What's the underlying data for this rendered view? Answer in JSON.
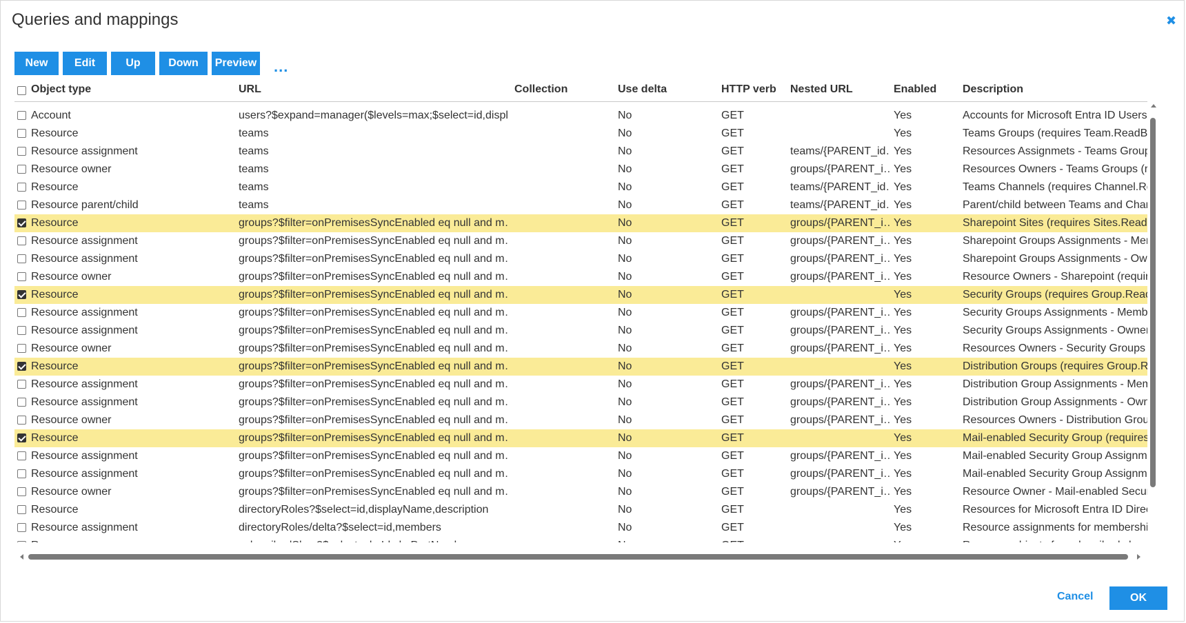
{
  "dialog": {
    "title": "Queries and mappings",
    "close_icon": "close-icon",
    "cancel_label": "Cancel",
    "ok_label": "OK"
  },
  "toolbar": {
    "buttons": [
      {
        "label": "New"
      },
      {
        "label": "Edit"
      },
      {
        "label": "Up"
      },
      {
        "label": "Down"
      },
      {
        "label": "Preview"
      }
    ],
    "more_label": "..."
  },
  "colors": {
    "accent": "#1f8fe5",
    "selected_row": "#faeb97"
  },
  "table": {
    "columns": [
      "Object type",
      "URL",
      "Collection",
      "Use delta",
      "HTTP verb",
      "Nested URL",
      "Enabled",
      "Description"
    ],
    "rows": [
      {
        "checked": false,
        "type": "Account",
        "url": "users?$expand=manager($levels=max;$select=id,displ…",
        "collection": "",
        "delta": "No",
        "verb": "GET",
        "nested": "",
        "enabled": "Yes",
        "desc": "Accounts for Microsoft Entra ID Users ("
      },
      {
        "checked": false,
        "type": "Resource",
        "url": "teams",
        "collection": "",
        "delta": "No",
        "verb": "GET",
        "nested": "",
        "enabled": "Yes",
        "desc": "Teams Groups (requires Team.ReadBa"
      },
      {
        "checked": false,
        "type": "Resource assignment",
        "url": "teams",
        "collection": "",
        "delta": "No",
        "verb": "GET",
        "nested": "teams/{PARENT_id…",
        "enabled": "Yes",
        "desc": "Resources Assignmets - Teams Groups"
      },
      {
        "checked": false,
        "type": "Resource owner",
        "url": "teams",
        "collection": "",
        "delta": "No",
        "verb": "GET",
        "nested": "groups/{PARENT_i…",
        "enabled": "Yes",
        "desc": "Resources Owners - Teams Groups (re"
      },
      {
        "checked": false,
        "type": "Resource",
        "url": "teams",
        "collection": "",
        "delta": "No",
        "verb": "GET",
        "nested": "teams/{PARENT_id…",
        "enabled": "Yes",
        "desc": "Teams Channels (requires Channel.Rea"
      },
      {
        "checked": false,
        "type": "Resource parent/child",
        "url": "teams",
        "collection": "",
        "delta": "No",
        "verb": "GET",
        "nested": "teams/{PARENT_id…",
        "enabled": "Yes",
        "desc": "Parent/child between Teams and Chan"
      },
      {
        "checked": true,
        "type": "Resource",
        "url": "groups?$filter=onPremisesSyncEnabled eq null and m…",
        "collection": "",
        "delta": "No",
        "verb": "GET",
        "nested": "groups/{PARENT_i…",
        "enabled": "Yes",
        "desc": "Sharepoint Sites (requires Sites.Read.A"
      },
      {
        "checked": false,
        "type": "Resource assignment",
        "url": "groups?$filter=onPremisesSyncEnabled eq null and m…",
        "collection": "",
        "delta": "No",
        "verb": "GET",
        "nested": "groups/{PARENT_i…",
        "enabled": "Yes",
        "desc": "Sharepoint Groups Assignments - Mem"
      },
      {
        "checked": false,
        "type": "Resource assignment",
        "url": "groups?$filter=onPremisesSyncEnabled eq null and m…",
        "collection": "",
        "delta": "No",
        "verb": "GET",
        "nested": "groups/{PARENT_i…",
        "enabled": "Yes",
        "desc": "Sharepoint Groups Assignments - Own"
      },
      {
        "checked": false,
        "type": "Resource owner",
        "url": "groups?$filter=onPremisesSyncEnabled eq null and m…",
        "collection": "",
        "delta": "No",
        "verb": "GET",
        "nested": "groups/{PARENT_i…",
        "enabled": "Yes",
        "desc": "Resource Owners - Sharepoint (require"
      },
      {
        "checked": true,
        "type": "Resource",
        "url": "groups?$filter=onPremisesSyncEnabled eq null and m…",
        "collection": "",
        "delta": "No",
        "verb": "GET",
        "nested": "",
        "enabled": "Yes",
        "desc": "Security Groups (requires Group.Read."
      },
      {
        "checked": false,
        "type": "Resource assignment",
        "url": "groups?$filter=onPremisesSyncEnabled eq null and m…",
        "collection": "",
        "delta": "No",
        "verb": "GET",
        "nested": "groups/{PARENT_i…",
        "enabled": "Yes",
        "desc": "Security Groups Assignments - Membe"
      },
      {
        "checked": false,
        "type": "Resource assignment",
        "url": "groups?$filter=onPremisesSyncEnabled eq null and m…",
        "collection": "",
        "delta": "No",
        "verb": "GET",
        "nested": "groups/{PARENT_i…",
        "enabled": "Yes",
        "desc": "Security Groups Assignments - Owners"
      },
      {
        "checked": false,
        "type": "Resource owner",
        "url": "groups?$filter=onPremisesSyncEnabled eq null and m…",
        "collection": "",
        "delta": "No",
        "verb": "GET",
        "nested": "groups/{PARENT_i…",
        "enabled": "Yes",
        "desc": "Resources Owners - Security Groups (r"
      },
      {
        "checked": true,
        "type": "Resource",
        "url": "groups?$filter=onPremisesSyncEnabled eq null and m…",
        "collection": "",
        "delta": "No",
        "verb": "GET",
        "nested": "",
        "enabled": "Yes",
        "desc": "Distribution Groups (requires Group.Re"
      },
      {
        "checked": false,
        "type": "Resource assignment",
        "url": "groups?$filter=onPremisesSyncEnabled eq null and m…",
        "collection": "",
        "delta": "No",
        "verb": "GET",
        "nested": "groups/{PARENT_i…",
        "enabled": "Yes",
        "desc": "Distribution Group Assignments - Mem"
      },
      {
        "checked": false,
        "type": "Resource assignment",
        "url": "groups?$filter=onPremisesSyncEnabled eq null and m…",
        "collection": "",
        "delta": "No",
        "verb": "GET",
        "nested": "groups/{PARENT_i…",
        "enabled": "Yes",
        "desc": "Distribution Group Assignments - Own"
      },
      {
        "checked": false,
        "type": "Resource owner",
        "url": "groups?$filter=onPremisesSyncEnabled eq null and m…",
        "collection": "",
        "delta": "No",
        "verb": "GET",
        "nested": "groups/{PARENT_i…",
        "enabled": "Yes",
        "desc": "Resources Owners - Distribution Grouj"
      },
      {
        "checked": true,
        "type": "Resource",
        "url": "groups?$filter=onPremisesSyncEnabled eq null and m…",
        "collection": "",
        "delta": "No",
        "verb": "GET",
        "nested": "",
        "enabled": "Yes",
        "desc": "Mail-enabled Security Group (requires"
      },
      {
        "checked": false,
        "type": "Resource assignment",
        "url": "groups?$filter=onPremisesSyncEnabled eq null and m…",
        "collection": "",
        "delta": "No",
        "verb": "GET",
        "nested": "groups/{PARENT_i…",
        "enabled": "Yes",
        "desc": "Mail-enabled Security Group Assignme"
      },
      {
        "checked": false,
        "type": "Resource assignment",
        "url": "groups?$filter=onPremisesSyncEnabled eq null and m…",
        "collection": "",
        "delta": "No",
        "verb": "GET",
        "nested": "groups/{PARENT_i…",
        "enabled": "Yes",
        "desc": "Mail-enabled Security Group Assignme"
      },
      {
        "checked": false,
        "type": "Resource owner",
        "url": "groups?$filter=onPremisesSyncEnabled eq null and m…",
        "collection": "",
        "delta": "No",
        "verb": "GET",
        "nested": "groups/{PARENT_i…",
        "enabled": "Yes",
        "desc": "Resource Owner - Mail-enabled Securit"
      },
      {
        "checked": false,
        "type": "Resource",
        "url": "directoryRoles?$select=id,displayName,description",
        "collection": "",
        "delta": "No",
        "verb": "GET",
        "nested": "",
        "enabled": "Yes",
        "desc": "Resources for Microsoft Entra ID Direc"
      },
      {
        "checked": false,
        "type": "Resource assignment",
        "url": "directoryRoles/delta?$select=id,members",
        "collection": "",
        "delta": "No",
        "verb": "GET",
        "nested": "",
        "enabled": "Yes",
        "desc": "Resource assignments for membershi"
      },
      {
        "checked": false,
        "type": "Resource",
        "url": "subscribedSkus?$select=skuId,skuPartNumber",
        "collection": "",
        "delta": "No",
        "verb": "GET",
        "nested": "",
        "enabled": "Yes",
        "desc": "Resource objects for subscribed skus a"
      }
    ]
  }
}
